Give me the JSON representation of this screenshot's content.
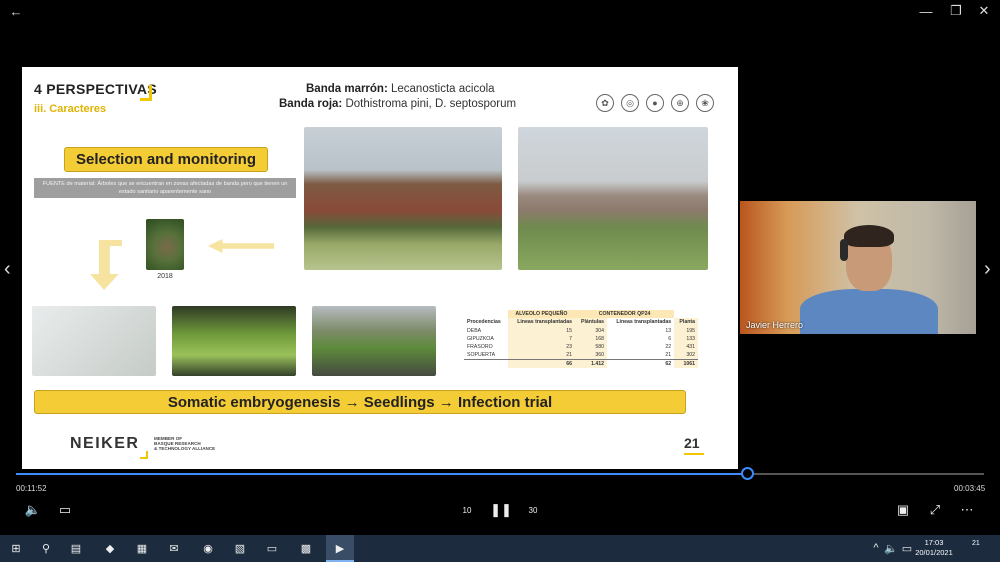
{
  "window": {
    "back_icon": "back-arrow-icon",
    "controls": [
      "minimize-icon",
      "restore-icon",
      "close-icon"
    ]
  },
  "slide": {
    "section_title": "4 PERSPECTIVAS",
    "section_sub": "iii.  Caracteres",
    "band1_label": "Banda marrón:",
    "band1_value": " Lecanosticta acicola",
    "band2_label": "Banda roja:",
    "band2_value": " Dothistroma pini, D. septosporum",
    "selection_title": "Selection and monitoring",
    "fuente_text": "FUENTE de material: Árboles que se encuentran en zonas afectadas de banda pero que tienen un estado sanitario aparentemente sano",
    "year": "2018",
    "table": {
      "group_headers": [
        "ALVEOLO PEQUEÑO",
        "CONTENEDOR QP24"
      ],
      "columns": [
        "Procedencias",
        "Lineas transplantadas",
        "Plántulas",
        "Lineas transplantadas",
        "Planta"
      ],
      "rows": [
        [
          "DEBA",
          "15",
          "304",
          "13",
          "195"
        ],
        [
          "GIPUZKOA",
          "7",
          "168",
          "6",
          "133"
        ],
        [
          "FRASORO",
          "23",
          "580",
          "22",
          "431"
        ],
        [
          "SOPUERTA",
          "21",
          "360",
          "21",
          "302"
        ]
      ],
      "totals": [
        "",
        "66",
        "1.412",
        "62",
        "1061"
      ]
    },
    "somatic_banner": "Somatic embryogenesis → Seedlings → Infection trial",
    "logo_text": "NEIKER",
    "member_line1": "MEMBER OF",
    "member_line2": "BASQUE RESEARCH",
    "member_line3": "& TECHNOLOGY ALLIANCE",
    "page_number": "21"
  },
  "participant": {
    "name": "Javier Herrero"
  },
  "player": {
    "current_time": "00:11:52",
    "remaining_time": "00:03:45",
    "progress": 0.755,
    "skip_back_label": "10",
    "skip_forward_label": "30"
  },
  "taskbar": {
    "time": "17:03",
    "date": "20/01/2021",
    "notification_count": "21"
  }
}
